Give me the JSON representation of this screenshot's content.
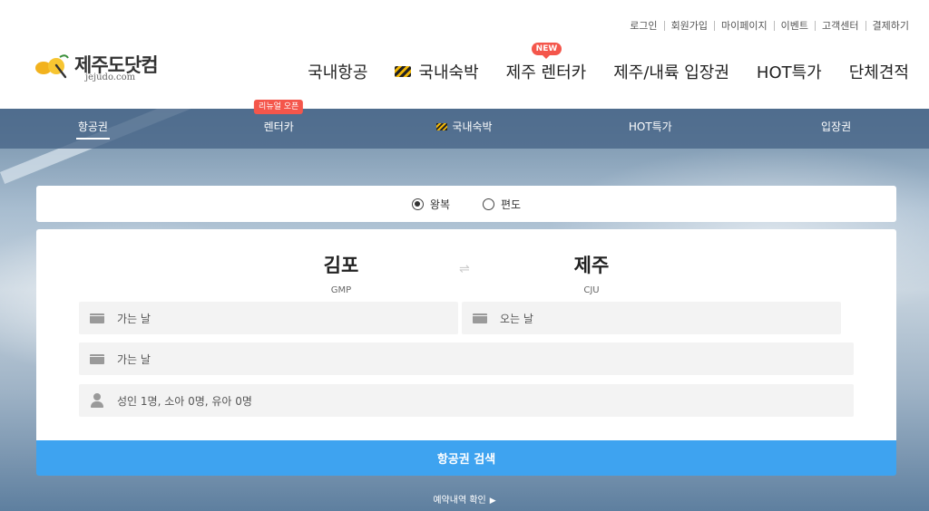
{
  "util_nav": [
    "로그인",
    "회원가입",
    "마이페이지",
    "이벤트",
    "고객센터",
    "결제하기"
  ],
  "logo": {
    "name": "제주도닷컴",
    "domain": "jejudo.com"
  },
  "gnb": {
    "items": [
      {
        "label": "국내항공"
      },
      {
        "label": "국내숙박",
        "icon": "stripe-icon"
      },
      {
        "label": "제주 렌터카",
        "badge": "NEW"
      },
      {
        "label": "제주/내륙 입장권"
      },
      {
        "label": "HOT특가"
      },
      {
        "label": "단체견적"
      }
    ]
  },
  "tabs": {
    "items": [
      {
        "label": "항공권",
        "active": true
      },
      {
        "label": "렌터카",
        "badge": "리뉴얼 오픈"
      },
      {
        "label": "국내숙박",
        "icon": "stripe-icon"
      },
      {
        "label": "HOT특가"
      },
      {
        "label": "입장권"
      }
    ]
  },
  "trip_type": {
    "options": [
      {
        "label": "왕복",
        "checked": true
      },
      {
        "label": "편도",
        "checked": false
      }
    ]
  },
  "route": {
    "from": {
      "city": "김포",
      "code": "GMP"
    },
    "to": {
      "city": "제주",
      "code": "CJU"
    },
    "swap_symbol": "⇌"
  },
  "fields": {
    "departure": "가는 날",
    "return": "오는 날",
    "departure2": "가는 날",
    "passengers": "성인 1명, 소아 0명, 유아 0명"
  },
  "search_button": "항공권 검색",
  "reservation_link": "예약내역 확인",
  "colors": {
    "accent_blue": "#3ea3f0",
    "badge_red": "#f4564b"
  }
}
